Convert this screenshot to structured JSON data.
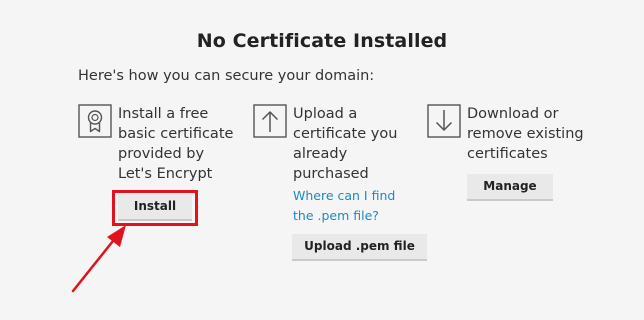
{
  "dialog": {
    "title": "No Certificate Installed",
    "intro": "Here's how you can secure your domain:"
  },
  "options": [
    {
      "icon": "certificate-icon",
      "lines": [
        "Install a free",
        "basic certificate",
        "provided by",
        "Let's Encrypt"
      ],
      "button_label": "Install"
    },
    {
      "icon": "upload-icon",
      "lines": [
        "Upload a",
        "certificate you",
        "already",
        "purchased"
      ],
      "link_lines": [
        "Where can I find",
        "the .pem file?"
      ],
      "button_label": "Upload .pem file"
    },
    {
      "icon": "download-icon",
      "lines": [
        "Download or",
        "remove existing",
        "certificates"
      ],
      "button_label": "Manage"
    }
  ],
  "annotation": {
    "highlight_color": "#e1121d",
    "arrow_color": "#e1121d"
  },
  "colors": {
    "background": "#f5f5f5",
    "link": "#1a8bc4",
    "button_bg": "#e9e9e9"
  }
}
